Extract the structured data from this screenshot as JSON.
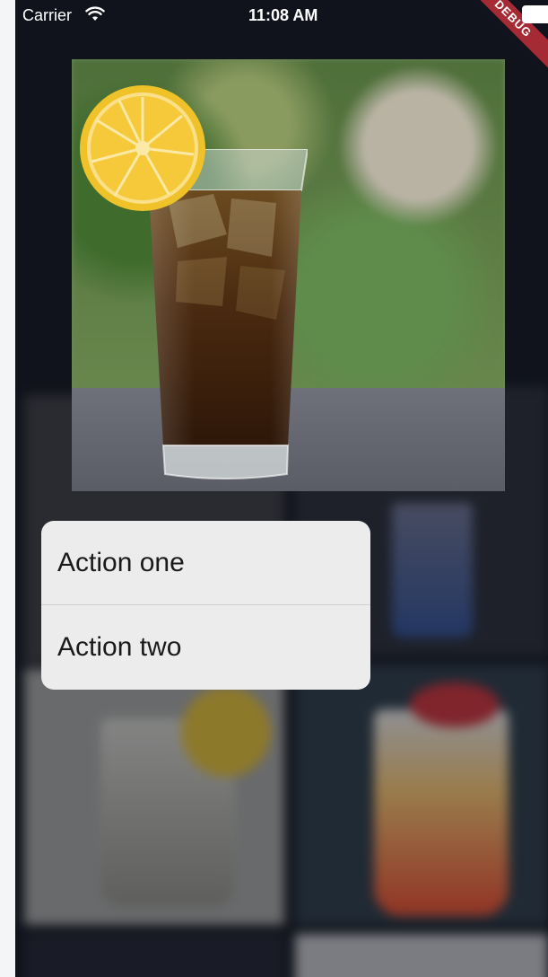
{
  "status_bar": {
    "carrier": "Carrier",
    "time": "11:08 AM",
    "wifi_icon": "wifi-icon",
    "battery_icon": "battery-icon"
  },
  "debug_banner": "DEBUG",
  "preview": {
    "image": "iced-tea-with-lemon"
  },
  "context_menu": {
    "items": [
      {
        "label": "Action one"
      },
      {
        "label": "Action two"
      }
    ]
  },
  "colors": {
    "background": "#151820",
    "menu_background": "#ececec",
    "debug_banner": "#a52a33"
  }
}
